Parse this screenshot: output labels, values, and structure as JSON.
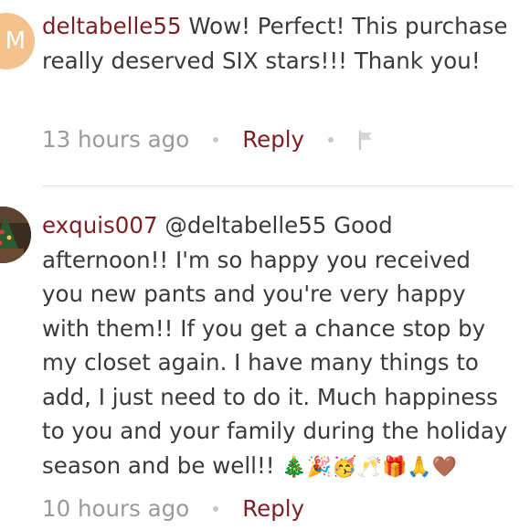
{
  "comments": [
    {
      "avatar_initial": "M",
      "username": "deltabelle55",
      "text": " Wow! Perfect! This purchase really deserved SIX stars!!! Thank you!",
      "timestamp": "13 hours ago",
      "reply_label": "Reply",
      "flag_icon": "flag-icon"
    },
    {
      "avatar_icon": "user-photo",
      "username": "exquis007",
      "text": " @deltabelle55 Good afternoon!! I'm so happy you received you new pants and you're very happy with them!! If you get a chance stop by my closet again. I have many things to add, I just need to do it. Much happiness to you and your family during the holiday season and be well!! ",
      "emojis": "🎄🎉🥳🥂🎁🙏🤎",
      "timestamp": "10 hours ago",
      "reply_label": "Reply"
    }
  ],
  "colors": {
    "username": "#7b1f24",
    "reply": "#7b1f24",
    "body_text": "#3a3a3a",
    "meta_text": "#9a9a9a",
    "avatar_bg": "#f3c28d"
  }
}
